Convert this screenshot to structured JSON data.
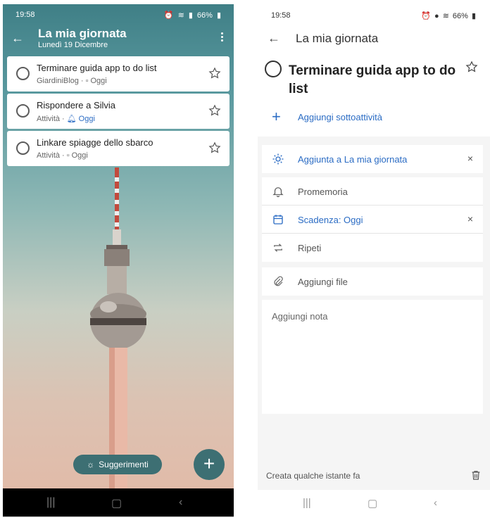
{
  "left": {
    "status": {
      "time": "19:58",
      "battery": "66%"
    },
    "header": {
      "title": "La mia giornata",
      "subtitle": "Lunedì 19 Dicembre"
    },
    "tasks": [
      {
        "title": "Terminare guida app to do list",
        "list": "GiardiniBlog",
        "sep": "·",
        "due": "Oggi",
        "due_blue": false
      },
      {
        "title": "Rispondere a Silvia",
        "list": "Attività",
        "sep": "·",
        "due": "Oggi",
        "due_blue": true
      },
      {
        "title": "Linkare spiagge dello sbarco",
        "list": "Attività",
        "sep": "·",
        "due": "Oggi",
        "due_blue": false
      }
    ],
    "suggestions_label": "Suggerimenti",
    "fab_label": "+"
  },
  "right": {
    "status": {
      "time": "19:58",
      "battery": "66%"
    },
    "header": {
      "title": "La mia giornata"
    },
    "task_title": "Terminare guida app to do list",
    "add_subtask": "Aggiungi sottoattività",
    "my_day": "Aggiunta a La mia giornata",
    "reminder": "Promemoria",
    "due": "Scadenza: Oggi",
    "repeat": "Ripeti",
    "add_file": "Aggiungi file",
    "add_note": "Aggiungi nota",
    "created": "Creata qualche istante fa",
    "close_glyph": "×"
  },
  "colors": {
    "accent_blue": "#2b6cc4",
    "teal": "#3d6f73"
  }
}
